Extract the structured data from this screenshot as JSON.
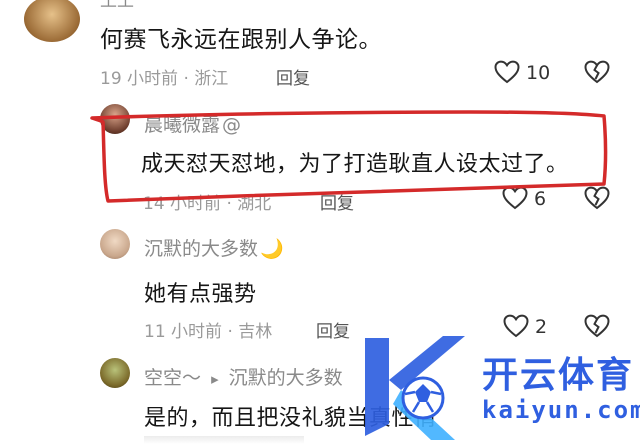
{
  "comments": [
    {
      "username": "王王",
      "text": "何赛飞永远在跟别人争论。",
      "meta": "19 小时前 · 浙江",
      "reply": "回复",
      "likes": "10"
    },
    {
      "username": "晨曦微露",
      "at": "@",
      "text": "成天怼天怼地，为了打造耿直人设太过了。",
      "meta": "14 小时前 · 湖北",
      "reply": "回复",
      "likes": "6"
    },
    {
      "username": "沉默的大多数",
      "emoji": "🌙",
      "text": "她有点强势",
      "meta": "11 小时前 · 吉林",
      "reply": "回复",
      "likes": "2"
    },
    {
      "username": "空空～",
      "reply_arrow": "▸",
      "reply_to": "沉默的大多数",
      "text": "是的，而且把没礼貌当真性情"
    }
  ],
  "watermark": {
    "brand": "开云体育",
    "site": "kaiyun.com"
  },
  "colors": {
    "highlight_red": "#d42a2a",
    "watermark_blue": "#2f5fe0",
    "meta_gray": "#9a9a9a"
  }
}
